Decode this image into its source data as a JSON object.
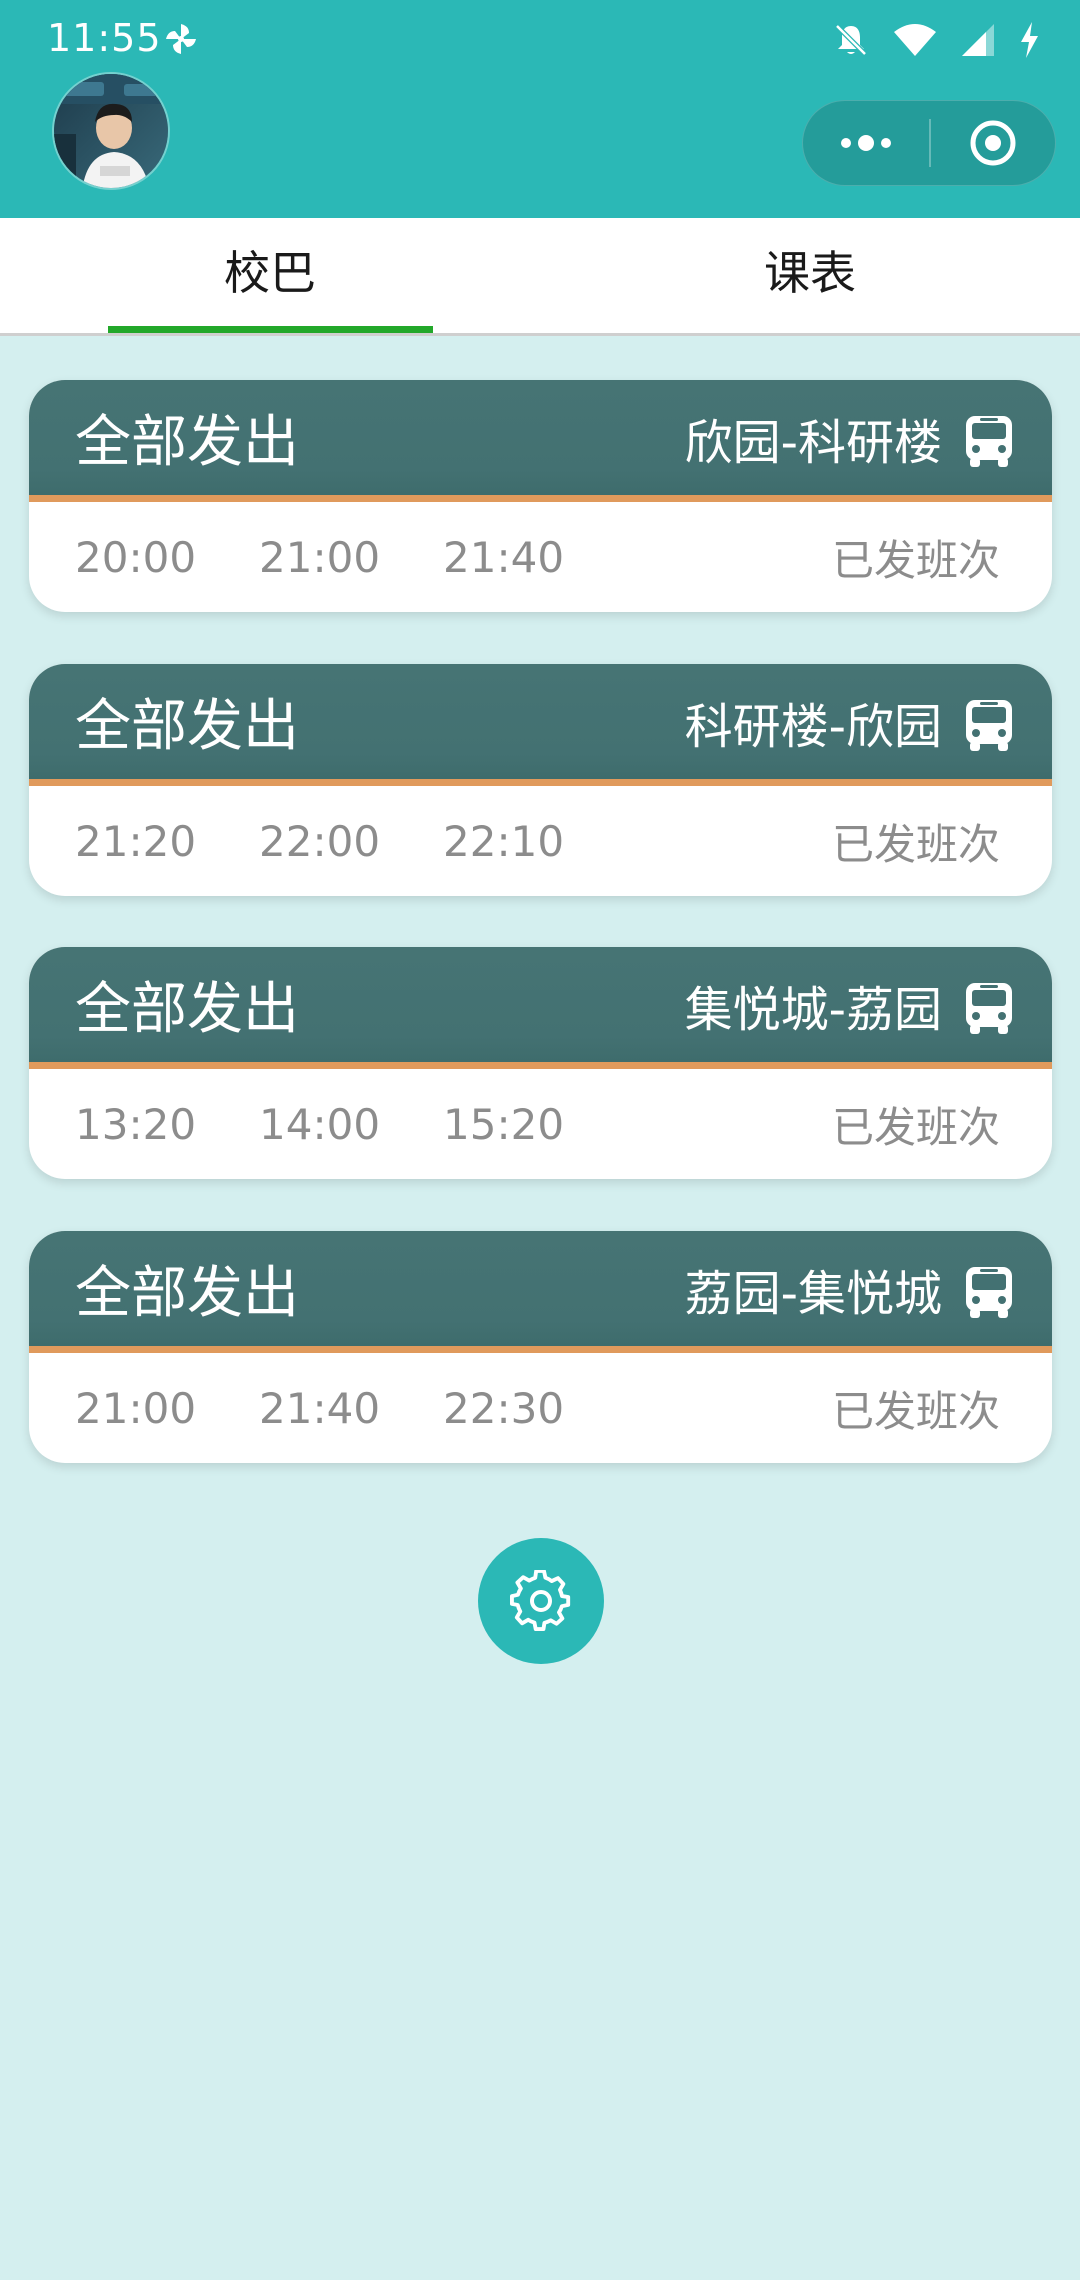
{
  "status_bar": {
    "time": "11:55",
    "icons": [
      "pinwheel-icon",
      "bell-off-icon",
      "wifi-icon",
      "cell-signal-icon",
      "charging-icon"
    ]
  },
  "header": {
    "avatar": "avatar",
    "capsule": {
      "more_icon": "more-dots-icon",
      "close_icon": "target-close-icon"
    }
  },
  "tabs": [
    {
      "label": "校巴",
      "active": true
    },
    {
      "label": "课表",
      "active": false
    }
  ],
  "colors": {
    "accent": "#2bb8b6",
    "card_header": "#437172",
    "card_stripe": "#e09a5c",
    "tab_indicator": "#22a82a",
    "page_background": "#d4efef",
    "time_text": "#8c8c8c"
  },
  "bus_cards": [
    {
      "status": "全部发出",
      "route": "欣园-科研楼",
      "times": [
        "20:00",
        "21:00",
        "21:40"
      ],
      "departed_label": "已发班次"
    },
    {
      "status": "全部发出",
      "route": "科研楼-欣园",
      "times": [
        "21:20",
        "22:00",
        "22:10"
      ],
      "departed_label": "已发班次"
    },
    {
      "status": "全部发出",
      "route": "集悦城-荔园",
      "times": [
        "13:20",
        "14:00",
        "15:20"
      ],
      "departed_label": "已发班次"
    },
    {
      "status": "全部发出",
      "route": "荔园-集悦城",
      "times": [
        "21:00",
        "21:40",
        "22:30"
      ],
      "departed_label": "已发班次"
    }
  ],
  "settings_button": {
    "icon": "gear-icon"
  }
}
